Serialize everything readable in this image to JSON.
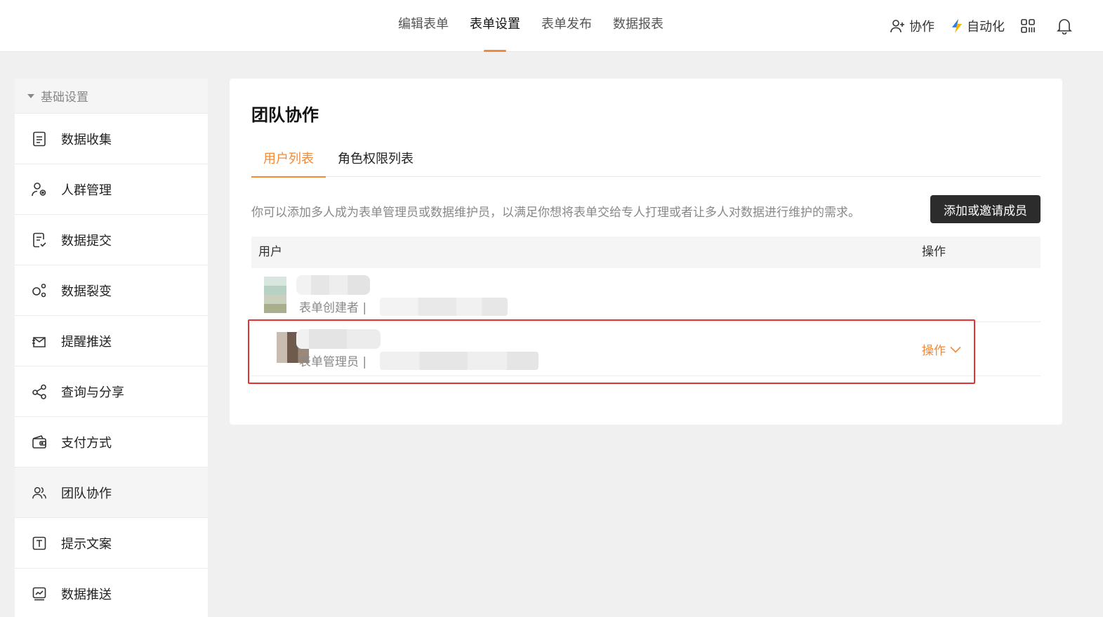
{
  "topnav": {
    "items": [
      "编辑表单",
      "表单设置",
      "表单发布",
      "数据报表"
    ],
    "active": 1
  },
  "topright": {
    "collab_label": "协作",
    "automation_label": "自动化"
  },
  "sidebar": {
    "section_title": "基础设置",
    "items": [
      {
        "label": "数据收集",
        "icon": "document-icon"
      },
      {
        "label": "人群管理",
        "icon": "user-settings-icon"
      },
      {
        "label": "数据提交",
        "icon": "submit-document-icon"
      },
      {
        "label": "数据裂变",
        "icon": "fission-icon"
      },
      {
        "label": "提醒推送",
        "icon": "reminder-push-icon"
      },
      {
        "label": "查询与分享",
        "icon": "share-icon"
      },
      {
        "label": "支付方式",
        "icon": "wallet-icon"
      },
      {
        "label": "团队协作",
        "icon": "team-icon"
      },
      {
        "label": "提示文案",
        "icon": "text-icon"
      },
      {
        "label": "数据推送",
        "icon": "chart-push-icon"
      }
    ],
    "active": 7
  },
  "main": {
    "title": "团队协作",
    "tabs": [
      "用户列表",
      "角色权限列表"
    ],
    "active_tab": 0,
    "description": "你可以添加多人成为表单管理员或数据维护员，以满足你想将表单交给专人打理或者让多人对数据进行维护的需求。",
    "add_button": "添加或邀请成员",
    "table": {
      "columns": [
        "用户",
        "操作"
      ],
      "rows": [
        {
          "role": "表单创建者 |",
          "action": ""
        },
        {
          "role": "表单管理员 |",
          "action": "操作"
        }
      ]
    }
  },
  "colors": {
    "accent": "#f28a3a",
    "highlight_border": "#e23333",
    "button_bg": "#2c2c2c"
  }
}
